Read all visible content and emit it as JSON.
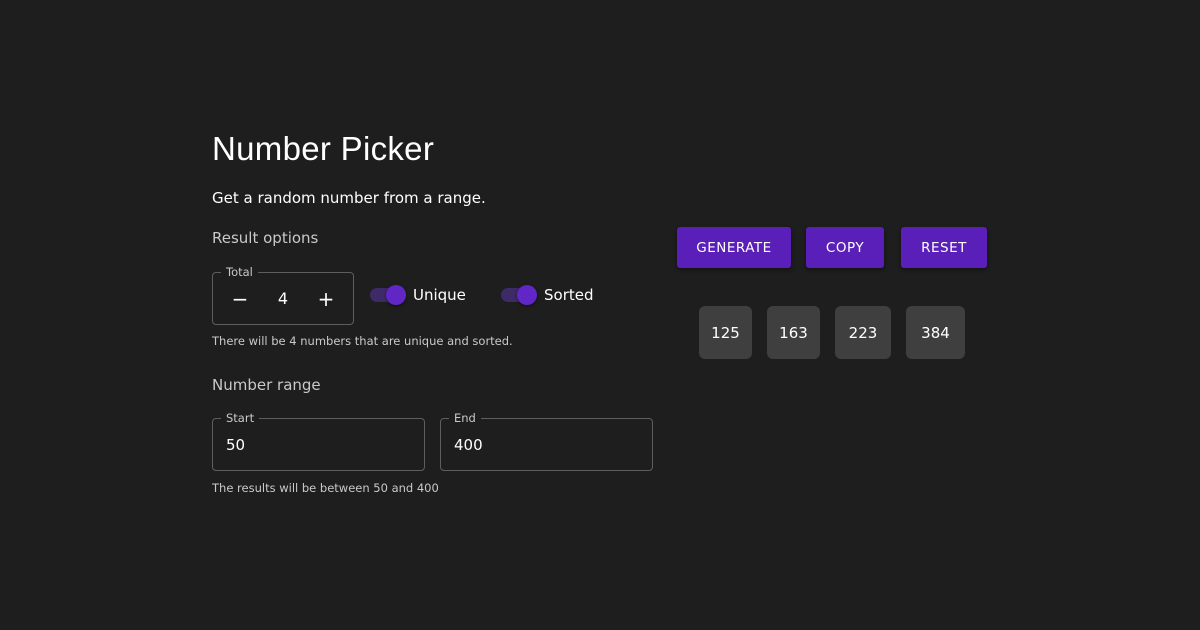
{
  "header": {
    "title": "Number Picker",
    "subtitle": "Get a random number from a range."
  },
  "result_options": {
    "heading": "Result options",
    "total": {
      "label": "Total",
      "value": "4",
      "decrement": "−",
      "increment": "+"
    },
    "unique": {
      "label": "Unique",
      "checked": true
    },
    "sorted": {
      "label": "Sorted",
      "checked": true
    },
    "helper": "There will be 4 numbers that are unique and sorted."
  },
  "number_range": {
    "heading": "Number range",
    "start": {
      "label": "Start",
      "value": "50"
    },
    "end": {
      "label": "End",
      "value": "400"
    },
    "helper": "The results will be between 50 and 400"
  },
  "actions": {
    "generate": "GENERATE",
    "copy": "COPY",
    "reset": "RESET"
  },
  "results": [
    "125",
    "163",
    "223",
    "384"
  ],
  "colors": {
    "background": "#1e1e1e",
    "accent": "#5a1fb8",
    "chip": "#3f3f3f"
  }
}
